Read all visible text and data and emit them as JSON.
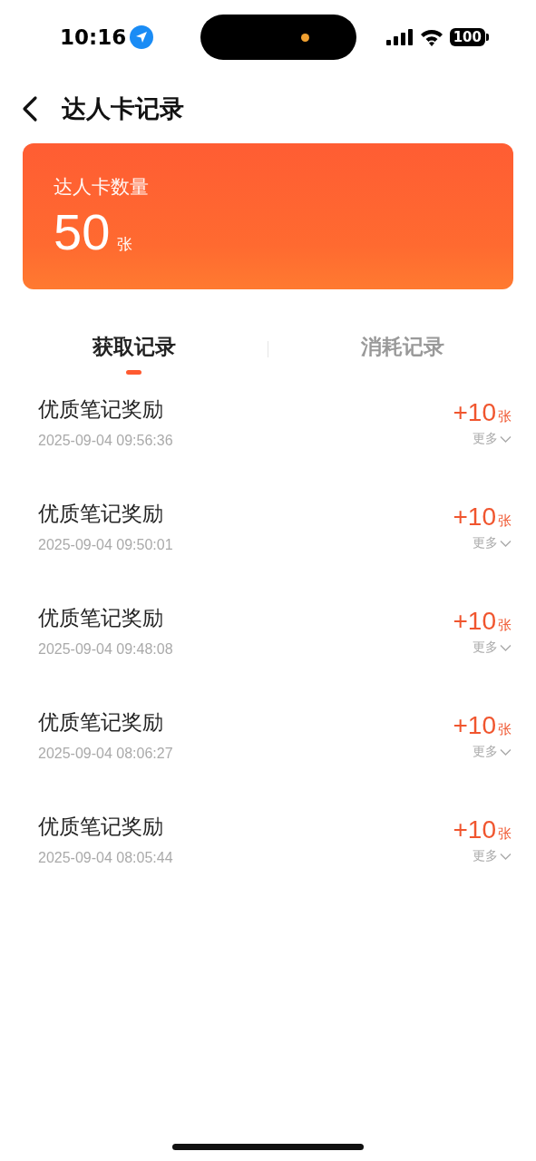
{
  "status_bar": {
    "time": "10:16",
    "battery": "100"
  },
  "header": {
    "title": "达人卡记录"
  },
  "summary": {
    "label": "达人卡数量",
    "count": "50",
    "unit": "张"
  },
  "tabs": [
    {
      "label": "获取记录",
      "selected": true
    },
    {
      "label": "消耗记录",
      "selected": false
    }
  ],
  "records": [
    {
      "title": "优质笔记奖励",
      "time": "2025-09-04 09:56:36",
      "amount": "+10",
      "unit": "张",
      "more": "更多"
    },
    {
      "title": "优质笔记奖励",
      "time": "2025-09-04 09:50:01",
      "amount": "+10",
      "unit": "张",
      "more": "更多"
    },
    {
      "title": "优质笔记奖励",
      "time": "2025-09-04 09:48:08",
      "amount": "+10",
      "unit": "张",
      "more": "更多"
    },
    {
      "title": "优质笔记奖励",
      "time": "2025-09-04 08:06:27",
      "amount": "+10",
      "unit": "张",
      "more": "更多"
    },
    {
      "title": "优质笔记奖励",
      "time": "2025-09-04 08:05:44",
      "amount": "+10",
      "unit": "张",
      "more": "更多"
    }
  ]
}
